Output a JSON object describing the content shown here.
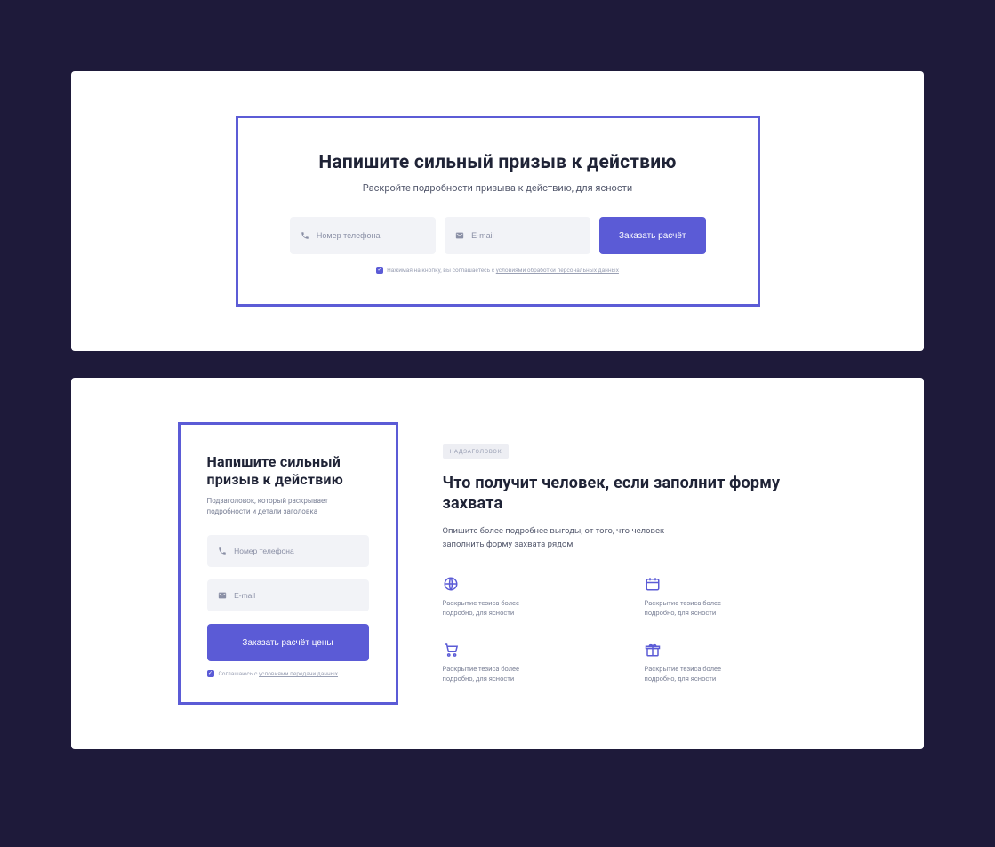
{
  "section1": {
    "title": "Напишите сильный призыв к действию",
    "subtitle": "Раскройте подробности призыва к действию, для ясности",
    "phone_placeholder": "Номер телефона",
    "email_placeholder": "E-mail",
    "button_label": "Заказать расчёт",
    "consent_prefix": "Нажимая на кнопку, вы соглашаетесь с ",
    "consent_link": "условиями обработки персональных данных"
  },
  "section2": {
    "form": {
      "title": "Напишите сильный призыв к действию",
      "subtitle": "Подзаголовок, который раскрывает подробности и детали заголовка",
      "phone_placeholder": "Номер телефона",
      "email_placeholder": "E-mail",
      "button_label": "Заказать расчёт цены",
      "consent_prefix": "Соглашаюсь с ",
      "consent_link": "условиями передачи данных"
    },
    "content": {
      "overline": "НАДЗАГОЛОВОК",
      "title": "Что получит человек, если заполнит форму захвата",
      "subtitle": "Опишите более подробнее выгоды, от того, что человек заполнить форму захвата рядом",
      "features": [
        {
          "icon": "globe",
          "text": "Раскрытие тезиса более подробно, для ясности"
        },
        {
          "icon": "calendar",
          "text": "Раскрытие тезиса более подробно, для ясности"
        },
        {
          "icon": "cart",
          "text": "Раскрытие тезиса более подробно, для ясности"
        },
        {
          "icon": "gift",
          "text": "Раскрытие тезиса более подробно, для ясности"
        }
      ]
    }
  }
}
